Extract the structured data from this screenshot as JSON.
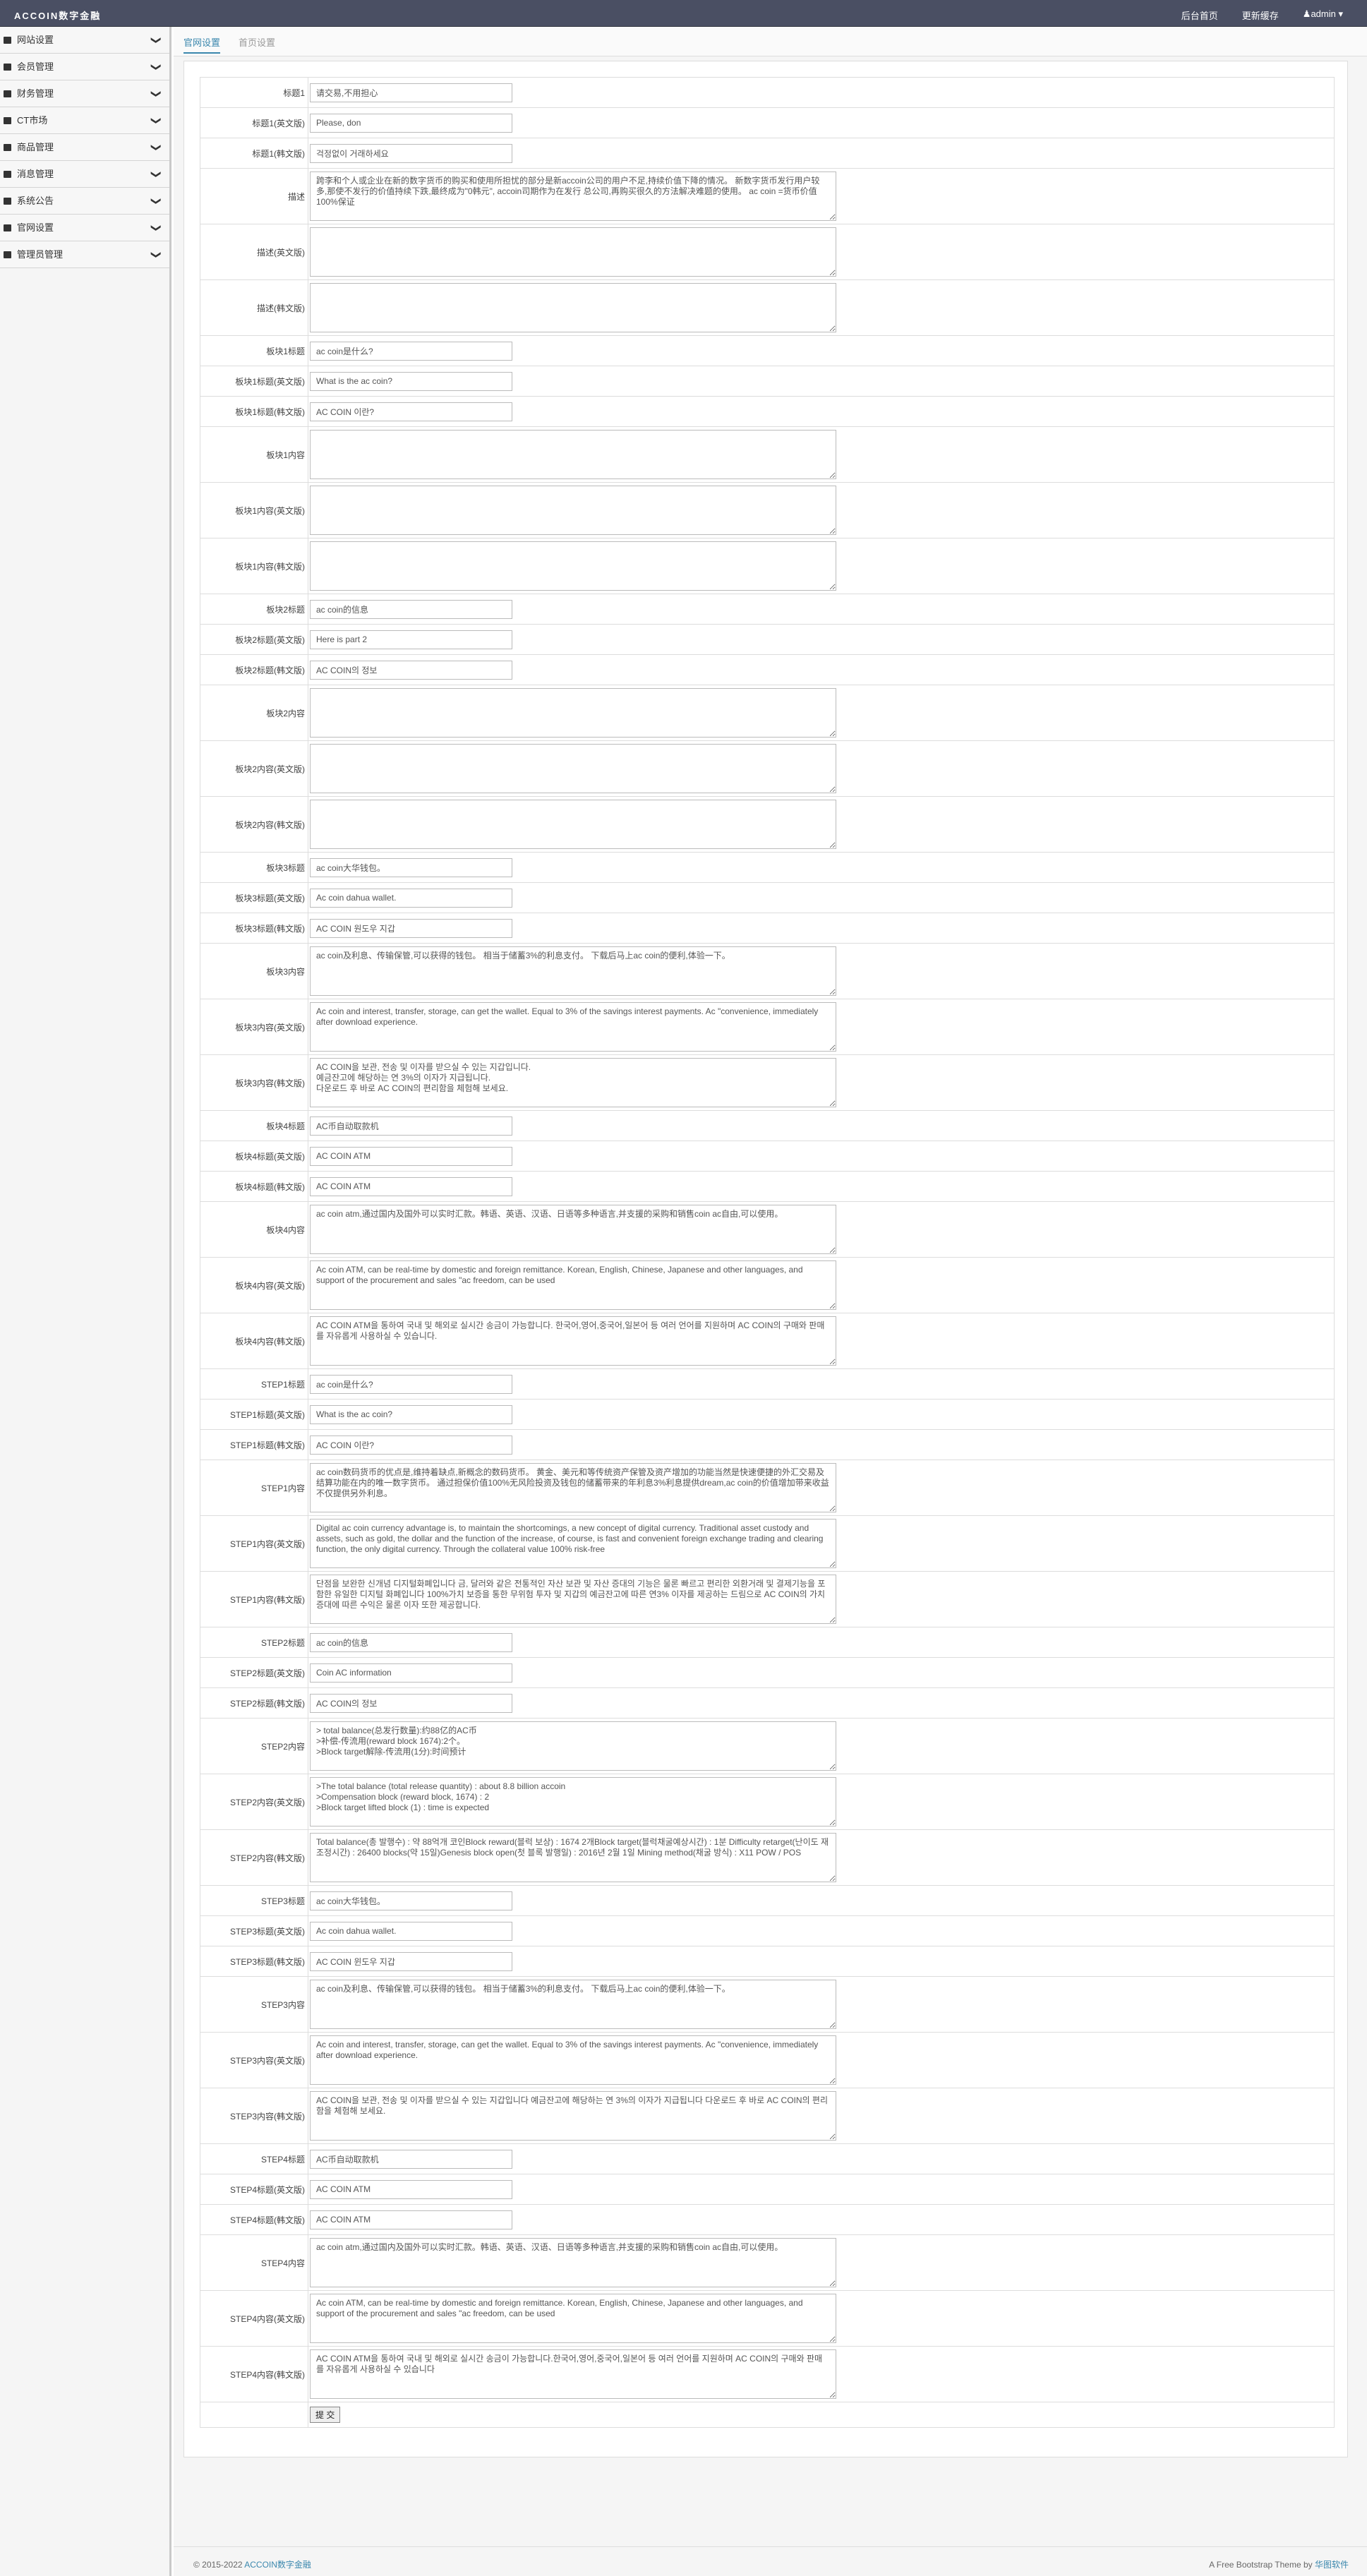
{
  "header": {
    "brand": "ACCOIN数字金融",
    "nav": [
      "后台首页",
      "更新缓存"
    ],
    "user": "admin ▾"
  },
  "sidebar": {
    "items": [
      {
        "label": "网站设置",
        "icon": "home-icon"
      },
      {
        "label": "会员管理",
        "icon": "users-icon"
      },
      {
        "label": "财务管理",
        "icon": "money-icon"
      },
      {
        "label": "CT市场",
        "icon": "market-icon"
      },
      {
        "label": "商品管理",
        "icon": "goods-icon"
      },
      {
        "label": "消息管理",
        "icon": "message-icon"
      },
      {
        "label": "系统公告",
        "icon": "notice-icon"
      },
      {
        "label": "官网设置",
        "icon": "globe-icon"
      },
      {
        "label": "管理员管理",
        "icon": "admin-icon"
      }
    ]
  },
  "tabs": [
    "官网设置",
    "首页设置"
  ],
  "form": {
    "rows": [
      {
        "label": "标题1",
        "type": "input",
        "value": "请交易,不用担心"
      },
      {
        "label": "标题1(英文版)",
        "type": "input",
        "value": "Please, don"
      },
      {
        "label": "标题1(韩文版)",
        "type": "input",
        "value": "걱정없이 거래하세요"
      },
      {
        "label": "描述",
        "type": "textarea",
        "value": "跨李和个人或企业在新的数字货币的购买和使用所担忧的部分是新accoin公司的用户不足,持续价值下降的情况。 新数字货币发行用户较多,那使不发行的价值持续下跌,最终成为\"0韩元\", accoin司期作为在发行 总公司,再购买很久的方法解决难题的使用。 ac coin =货币价值100%保证"
      },
      {
        "label": "描述(英文版)",
        "type": "textarea",
        "value": ""
      },
      {
        "label": "描述(韩文版)",
        "type": "textarea",
        "value": ""
      },
      {
        "label": "板块1标题",
        "type": "input",
        "value": "ac coin是什么?"
      },
      {
        "label": "板块1标题(英文版)",
        "type": "input",
        "value": "What is the ac coin?"
      },
      {
        "label": "板块1标题(韩文版)",
        "type": "input",
        "value": "AC COIN 이란?"
      },
      {
        "label": "板块1内容",
        "type": "textarea",
        "value": ""
      },
      {
        "label": "板块1内容(英文版)",
        "type": "textarea",
        "value": ""
      },
      {
        "label": "板块1内容(韩文版)",
        "type": "textarea",
        "value": ""
      },
      {
        "label": "板块2标题",
        "type": "input",
        "value": "ac coin的信息"
      },
      {
        "label": "板块2标题(英文版)",
        "type": "input",
        "value": "Here is part 2"
      },
      {
        "label": "板块2标题(韩文版)",
        "type": "input",
        "value": "AC COIN의 정보"
      },
      {
        "label": "板块2内容",
        "type": "textarea",
        "value": ""
      },
      {
        "label": "板块2内容(英文版)",
        "type": "textarea",
        "value": ""
      },
      {
        "label": "板块2内容(韩文版)",
        "type": "textarea",
        "value": ""
      },
      {
        "label": "板块3标题",
        "type": "input",
        "value": "ac coin大华钱包。"
      },
      {
        "label": "板块3标题(英文版)",
        "type": "input",
        "value": "Ac coin dahua wallet."
      },
      {
        "label": "板块3标题(韩文版)",
        "type": "input",
        "value": "AC COIN 원도우 지갑"
      },
      {
        "label": "板块3内容",
        "type": "textarea",
        "value": "ac coin及利息、传输保管,可以获得的钱包。 相当于储蓄3%的利息支付。 下载后马上ac coin的便利,体验一下。"
      },
      {
        "label": "板块3内容(英文版)",
        "type": "textarea",
        "value": "Ac coin and interest, transfer, storage, can get the wallet. Equal to 3% of the savings interest payments. Ac \"convenience, immediately after download experience."
      },
      {
        "label": "板块3内容(韩文版)",
        "type": "textarea",
        "value": "AC COIN을 보관, 전송 및 이자를 받으실 수 있는 지갑입니다.\n예금잔고에 해당하는 연 3%의 이자가 지급됩니다.\n다운로드 후 바로 AC COIN의 편리함을 체험해 보세요."
      },
      {
        "label": "板块4标题",
        "type": "input",
        "value": "AC币自动取款机"
      },
      {
        "label": "板块4标题(英文版)",
        "type": "input",
        "value": "AC COIN ATM"
      },
      {
        "label": "板块4标题(韩文版)",
        "type": "input",
        "value": "AC COIN ATM"
      },
      {
        "label": "板块4内容",
        "type": "textarea",
        "value": "ac coin atm,通过国内及国外可以实时汇款。韩语、英语、汉语、日语等多种语言,并支援的采购和销售coin ac自由,可以使用。"
      },
      {
        "label": "板块4内容(英文版)",
        "type": "textarea",
        "value": "Ac coin ATM, can be real-time by domestic and foreign remittance. Korean, English, Chinese, Japanese and other languages, and support of the procurement and sales \"ac freedom, can be used"
      },
      {
        "label": "板块4内容(韩文版)",
        "type": "textarea",
        "value": "AC COIN ATM을 통하여 국내 및 해외로 실시간 송금이 가능합니다. 한국어,영어,중국어,일본어 등 여러 언어를 지원하며 AC COIN의 구매와 판매를 자유롭게 사용하실 수 있습니다."
      },
      {
        "label": "STEP1标题",
        "type": "input",
        "value": "ac coin是什么?"
      },
      {
        "label": "STEP1标题(英文版)",
        "type": "input",
        "value": "What is the ac coin?"
      },
      {
        "label": "STEP1标题(韩文版)",
        "type": "input",
        "value": "AC COIN 이란?"
      },
      {
        "label": "STEP1内容",
        "type": "textarea",
        "value": "ac coin数码货币的优点是,维持着缺点,新概念的数码货币。 黄金、美元和等传统资产保管及资产增加的功能当然是快速便捷的外汇交易及结算功能在内的唯一数字货币。 通过担保价值100%无风险投资及钱包的储蓄带来的年利息3%利息提供dream,ac coin的价值增加带来收益不仅提供另外利息。"
      },
      {
        "label": "STEP1内容(英文版)",
        "type": "textarea",
        "scroll": true,
        "value": "Digital ac coin currency advantage is, to maintain the shortcomings, a new concept of digital currency. Traditional asset custody and assets, such as gold, the dollar and the function of the increase, of course, is fast and convenient foreign exchange trading and clearing function, the only digital currency. Through the collateral value 100% risk-free"
      },
      {
        "label": "STEP1内容(韩文版)",
        "type": "textarea",
        "value": "단점을 보완한 신개념 디지털화폐입니다 금, 달러와 같은 전통적인 자산 보관 및 자산 증대의 기능은 물론 빠르고 편리한 외환거래 및 결제기능을 포함한 유일한 디지털 화폐입니다 100%가치 보증을 통한 무위험 투자 및 지갑의 예금잔고에 따른 연3% 이자를 제공하는 드림으로 AC COIN의 가치증대에 따른 수익은 물론 이자 또한 제공합니다."
      },
      {
        "label": "STEP2标题",
        "type": "input",
        "value": "ac coin的信息"
      },
      {
        "label": "STEP2标题(英文版)",
        "type": "input",
        "value": "Coin AC information"
      },
      {
        "label": "STEP2标题(韩文版)",
        "type": "input",
        "value": "AC COIN의 정보"
      },
      {
        "label": "STEP2内容",
        "type": "textarea",
        "scroll": true,
        "value": "> total balance(总发行数量):约88亿的AC币\n>补偿-传流用(reward block 1674):2个。\n>Block target解除-传流用(1分):时间预计"
      },
      {
        "label": "STEP2内容(英文版)",
        "type": "textarea",
        "scroll": true,
        "value": ">The total balance (total release quantity) : about 8.8 billion accoin\n>Compensation block (reward block, 1674) : 2\n>Block target lifted block (1) : time is expected"
      },
      {
        "label": "STEP2内容(韩文版)",
        "type": "textarea",
        "value": "Total balance(총 발행수) : 약 88억개 코인Block reward(블럭 보상) : 1674 2개Block target(블럭채굴예상시간) : 1분 Difficulty retarget(난이도 재조정시간) : 26400 blocks(약 15일)Genesis block open(첫 블록 발행일) : 2016년 2월 1일 Mining method(채굴 방식) : X11 POW / POS"
      },
      {
        "label": "STEP3标题",
        "type": "input",
        "value": "ac coin大华钱包。"
      },
      {
        "label": "STEP3标题(英文版)",
        "type": "input",
        "value": "Ac coin dahua wallet."
      },
      {
        "label": "STEP3标题(韩文版)",
        "type": "input",
        "value": "AC COIN 윈도우 지갑"
      },
      {
        "label": "STEP3内容",
        "type": "textarea",
        "value": "ac coin及利息、传输保管,可以获得的钱包。 相当于储蓄3%的利息支付。 下载后马上ac coin的便利,体验一下。"
      },
      {
        "label": "STEP3内容(英文版)",
        "type": "textarea",
        "value": "Ac coin and interest, transfer, storage, can get the wallet. Equal to 3% of the savings interest payments. Ac \"convenience, immediately after download experience."
      },
      {
        "label": "STEP3内容(韩文版)",
        "type": "textarea",
        "value": "AC COIN을 보관, 전송 및 이자를 받으실 수 있는 지갑입니다 예금잔고에 해당하는 연 3%의 이자가 지급됩니다 다운로드 후 바로 AC COIN의 편리함을 체험해 보세요."
      },
      {
        "label": "STEP4标题",
        "type": "input",
        "value": "AC币自动取款机"
      },
      {
        "label": "STEP4标题(英文版)",
        "type": "input",
        "value": "AC COIN ATM"
      },
      {
        "label": "STEP4标题(韩文版)",
        "type": "input",
        "value": "AC COIN ATM"
      },
      {
        "label": "STEP4内容",
        "type": "textarea",
        "value": "ac coin atm,通过国内及国外可以实时汇款。韩语、英语、汉语、日语等多种语言,并支援的采购和销售coin ac自由,可以使用。"
      },
      {
        "label": "STEP4内容(英文版)",
        "type": "textarea",
        "value": "Ac coin ATM, can be real-time by domestic and foreign remittance. Korean, English, Chinese, Japanese and other languages, and support of the procurement and sales \"ac freedom, can be used"
      },
      {
        "label": "STEP4内容(韩文版)",
        "type": "textarea",
        "value": "AC COIN ATM을 통하여 국내 및 해외로 실시간 송금이 가능합니다.한국어,영어,중국어,일본어 등 여러 언어를 지원하며 AC COIN의 구매와 판매를 자유롭게 사용하실 수 있습니다"
      }
    ],
    "submit_label": "提 交"
  },
  "footer": {
    "copyright": "© 2015-2022 ",
    "brand_link": "ACCOIN数字金融",
    "theme_text": "A Free Bootstrap Theme by ",
    "theme_link": "华图软件"
  },
  "colors": {
    "topbar": "#4a4f63",
    "link": "#3a87ad"
  }
}
